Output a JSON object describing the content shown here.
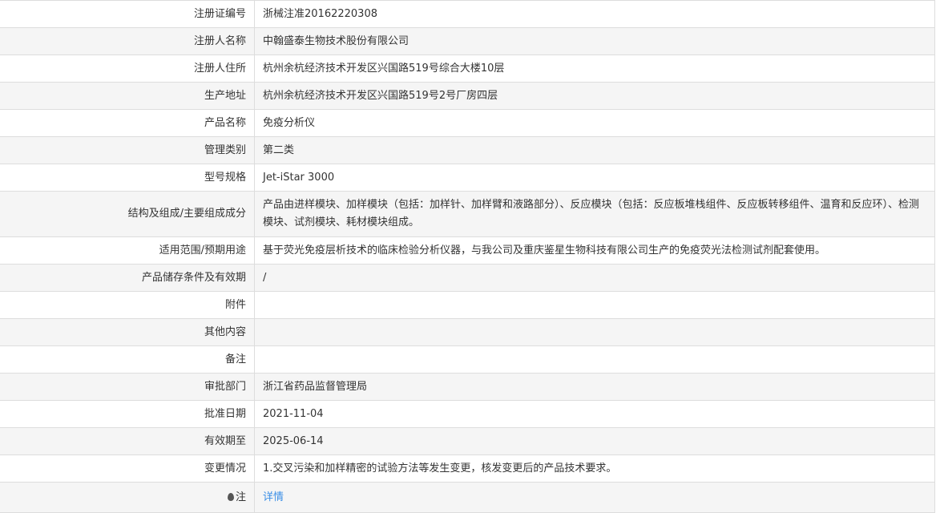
{
  "rows": [
    {
      "label": "注册证编号",
      "value": "浙械注准20162220308"
    },
    {
      "label": "注册人名称",
      "value": "中翰盛泰生物技术股份有限公司"
    },
    {
      "label": "注册人住所",
      "value": "杭州余杭经济技术开发区兴国路519号综合大楼10层"
    },
    {
      "label": "生产地址",
      "value": "杭州余杭经济技术开发区兴国路519号2号厂房四层"
    },
    {
      "label": "产品名称",
      "value": "免疫分析仪"
    },
    {
      "label": "管理类别",
      "value": "第二类"
    },
    {
      "label": "型号规格",
      "value": "Jet-iStar 3000"
    },
    {
      "label": "结构及组成/主要组成成分",
      "value": "产品由进样模块、加样模块（包括：加样针、加样臂和液路部分）、反应模块（包括：反应板堆栈组件、反应板转移组件、温育和反应环）、检测模块、试剂模块、耗材模块组成。"
    },
    {
      "label": "适用范围/预期用途",
      "value": "基于荧光免疫层析技术的临床检验分析仪器，与我公司及重庆鉴星生物科技有限公司生产的免疫荧光法检测试剂配套使用。"
    },
    {
      "label": "产品储存条件及有效期",
      "value": "/"
    },
    {
      "label": "附件",
      "value": ""
    },
    {
      "label": "其他内容",
      "value": ""
    },
    {
      "label": "备注",
      "value": ""
    },
    {
      "label": "审批部门",
      "value": "浙江省药品监督管理局"
    },
    {
      "label": "批准日期",
      "value": "2021-11-04"
    },
    {
      "label": "有效期至",
      "value": "2025-06-14"
    },
    {
      "label": "变更情况",
      "value": "1.交叉污染和加样精密的试验方法等发生变更，核发变更后的产品技术要求。"
    }
  ],
  "note": {
    "label": "注",
    "link": "详情"
  }
}
